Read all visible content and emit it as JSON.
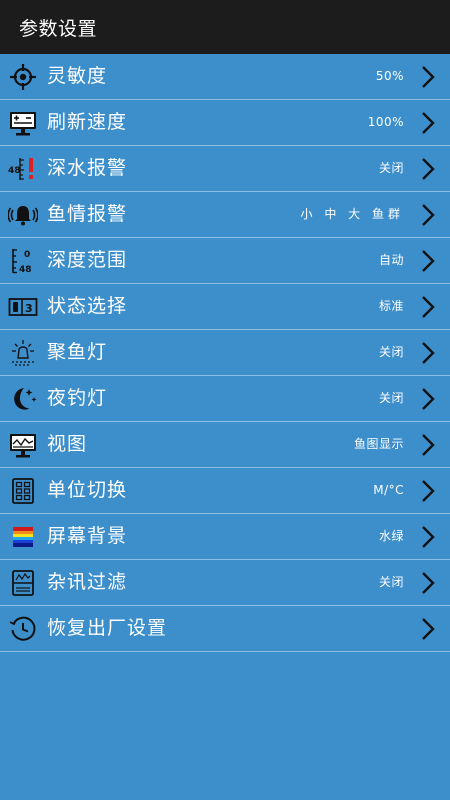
{
  "header": {
    "title": "参数设置"
  },
  "colors": {
    "background": "#3d8fcc",
    "header": "#1c1c1c",
    "divider": "#8fc1e6",
    "text": "#ffffff"
  },
  "items": [
    {
      "label": "灵敏度",
      "value": "50%",
      "icon": "crosshair-icon"
    },
    {
      "label": "刷新速度",
      "value": "100%",
      "icon": "monitor-refresh-icon"
    },
    {
      "label": "深水报警",
      "value": "关闭",
      "icon": "depth-alarm-icon"
    },
    {
      "label": "鱼情报警",
      "value": "小 中 大 鱼群",
      "icon": "bell-icon"
    },
    {
      "label": "深度范围",
      "value": "自动",
      "icon": "depth-range-icon"
    },
    {
      "label": "状态选择",
      "value": "标准",
      "icon": "status-icon"
    },
    {
      "label": "聚鱼灯",
      "value": "关闭",
      "icon": "fish-lamp-icon"
    },
    {
      "label": "夜钓灯",
      "value": "关闭",
      "icon": "moon-icon"
    },
    {
      "label": "视图",
      "value": "鱼图显示",
      "icon": "view-monitor-icon"
    },
    {
      "label": "单位切换",
      "value": "M/°C",
      "icon": "unit-grid-icon"
    },
    {
      "label": "屏幕背景",
      "value": "水绿",
      "icon": "color-palette-icon"
    },
    {
      "label": "杂讯过滤",
      "value": "关闭",
      "icon": "filter-icon"
    },
    {
      "label": "恢复出厂设置",
      "value": "",
      "icon": "clock-reset-icon"
    }
  ]
}
